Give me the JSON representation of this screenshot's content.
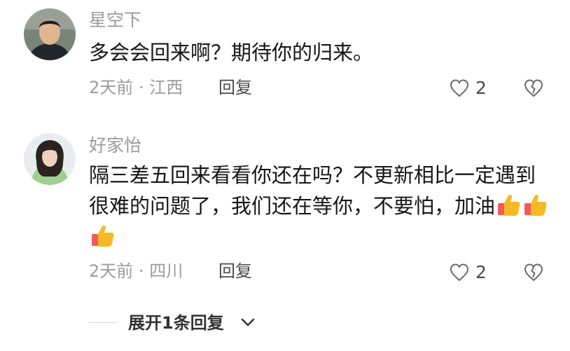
{
  "comments": [
    {
      "username": "星空下",
      "text": "多会会回来啊？期待你的归来。",
      "time": "2天前",
      "separator": "·",
      "location": "江西",
      "reply_label": "回复",
      "like_count": "2"
    },
    {
      "username": "好家怡",
      "text": "隔三差五回来看看你还在吗？不更新相比一定遇到很难的问题了，我们还在等你，不要怕，加油",
      "emojis": [
        "thumbs-up",
        "thumbs-up",
        "thumbs-up"
      ],
      "time": "2天前",
      "separator": "·",
      "location": "四川",
      "reply_label": "回复",
      "like_count": "2"
    }
  ],
  "expand_replies": {
    "label": "展开1条回复",
    "icon": "chevron-down-icon"
  },
  "colors": {
    "username": "#9a9a9a",
    "meta": "#9b9b9b",
    "text": "#161616",
    "thumbs_up_yellow": "#f7b825",
    "thumbs_up_cuff": "#f05a5a"
  }
}
